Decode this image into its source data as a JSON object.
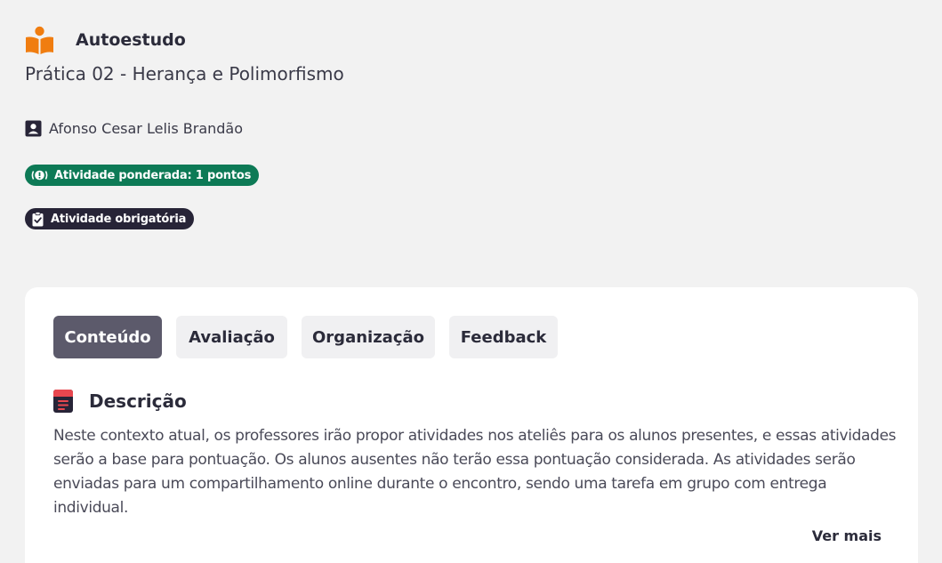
{
  "header": {
    "category": "Autoestudo",
    "category_icon": "reader-book-icon",
    "title": "Prática 02 - Herança e Polimorfismo"
  },
  "author": {
    "icon": "user-badge-icon",
    "name": "Afonso Cesar Lelis Brandão"
  },
  "badges": {
    "weighted": {
      "label": "Atividade ponderada: 1 pontos",
      "icon": "alert-circle-icon",
      "color": "#0d7a56"
    },
    "required": {
      "label": "Atividade obrigatória",
      "icon": "clipboard-check-icon",
      "color": "#272437"
    }
  },
  "card": {
    "tabs": [
      {
        "label": "Conteúdo",
        "active": true
      },
      {
        "label": "Avaliação",
        "active": false
      },
      {
        "label": "Organização",
        "active": false
      },
      {
        "label": "Feedback",
        "active": false
      }
    ],
    "section": {
      "icon": "document-icon",
      "title": "Descrição",
      "text": "Neste contexto atual, os professores irão propor atividades nos ateliês para os alunos presentes, e essas atividades serão a base para pontuação. Os alunos ausentes não terão essa pontuação considerada. As atividades serão enviadas para um compartilhamento online durante o encontro, sendo uma tarefa em grupo com entrega individual."
    },
    "see_more": "Ver mais"
  },
  "colors": {
    "accent_orange": "#f07d10",
    "active_tab": "#5c5a6b",
    "doc_icon_red": "#e8474f"
  }
}
